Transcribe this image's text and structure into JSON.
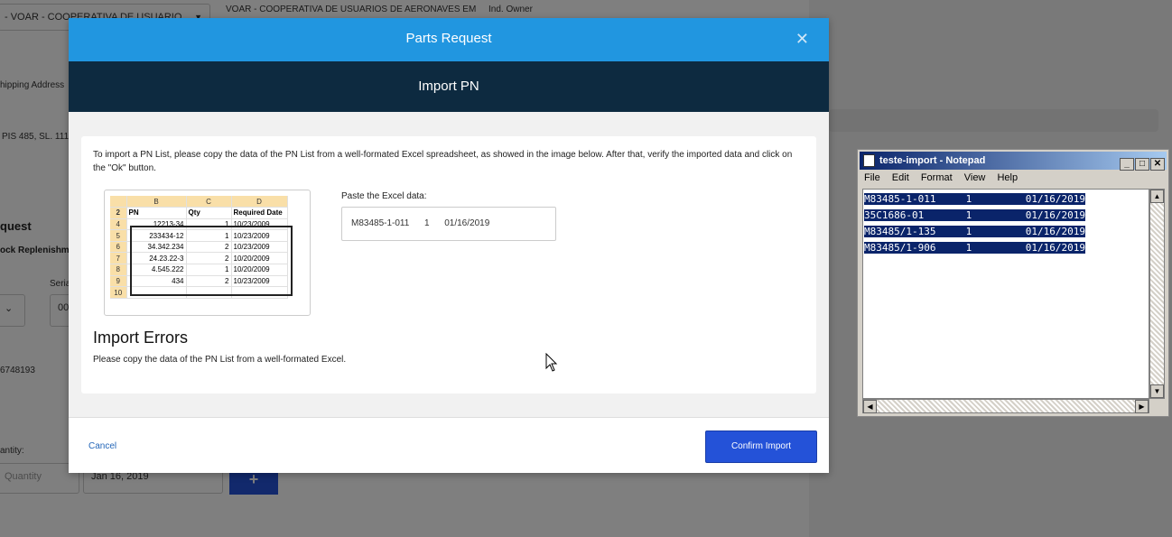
{
  "background": {
    "select_value": "- VOAR - COOPERATIVA DE USUARIO",
    "company_name": "VOAR - COOPERATIVA DE USUARIOS DE AERONAVES EM",
    "owner_label": "Ind. Owner",
    "shipping_label": "hipping Address",
    "address_value": "PIS 485, SL. 111,",
    "section_title": "quest",
    "replenish_label": "ock Replenishm",
    "serial_label": "Seria",
    "serial_value": "00",
    "phone_value": "6748193",
    "quantity_label": "antity:",
    "quantity_placeholder": "Quantity",
    "date_value": "Jan 16, 2019",
    "plus_label": "+"
  },
  "modal": {
    "title": "Parts Request",
    "close_label": "✕",
    "subtitle": "Import PN",
    "instructions": "To import a PN List, please copy the data of the PN List from a well-formated Excel spreadsheet, as showed in the image below. After that, verify the imported data and click on the \"Ok\" button.",
    "paste_label": "Paste the Excel data:",
    "paste_value": "M83485-1-011      1      01/16/2019",
    "errors_title": "Import Errors",
    "errors_text": "Please copy the data of the PN List from a well-formated Excel.",
    "cancel_label": "Cancel",
    "confirm_label": "Confirm Import"
  },
  "excel_example": {
    "col_headers": [
      "B",
      "C",
      "D"
    ],
    "header_row": {
      "row": "2",
      "pn": "PN",
      "qty": "Qty",
      "date": "Required Date"
    },
    "rows": [
      {
        "row": "4",
        "pn": "12213-34",
        "qty": "1",
        "date": "10/23/2009"
      },
      {
        "row": "5",
        "pn": "233434-12",
        "qty": "1",
        "date": "10/23/2009"
      },
      {
        "row": "6",
        "pn": "34.342.234",
        "qty": "2",
        "date": "10/23/2009"
      },
      {
        "row": "7",
        "pn": "24.23.22-3",
        "qty": "2",
        "date": "10/20/2009"
      },
      {
        "row": "8",
        "pn": "4.545.222",
        "qty": "1",
        "date": "10/20/2009"
      },
      {
        "row": "9",
        "pn": "434",
        "qty": "2",
        "date": "10/23/2009"
      },
      {
        "row": "10",
        "pn": "",
        "qty": "",
        "date": ""
      }
    ]
  },
  "notepad": {
    "title": "teste-import - Notepad",
    "menu": [
      "File",
      "Edit",
      "Format",
      "View",
      "Help"
    ],
    "lines": [
      "M83485-1-011     1         01/16/2019",
      "35C1686-01       1         01/16/2019",
      "M83485/1-135     1         01/16/2019",
      "M83485/1-906     1         01/16/2019"
    ]
  },
  "colors": {
    "header_blue": "#2196e0",
    "subheader_navy": "#0d2a40",
    "confirm_blue": "#2452d8",
    "selection": "#0a246a"
  }
}
